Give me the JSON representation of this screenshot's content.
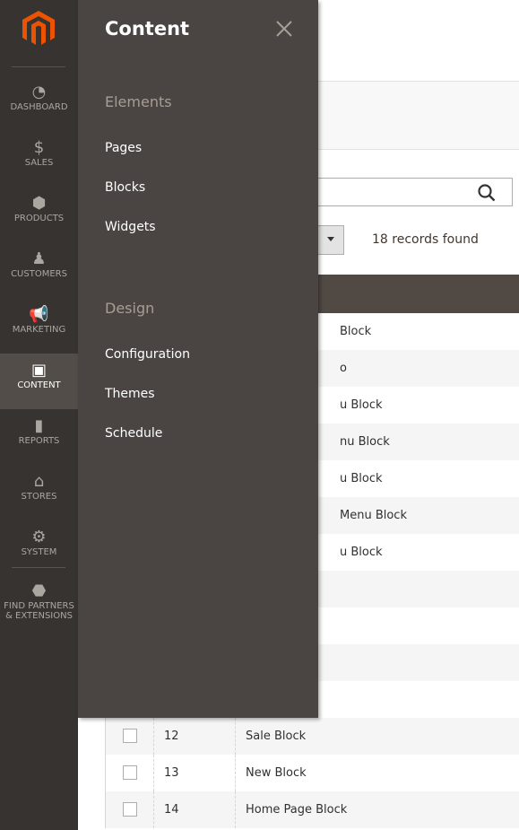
{
  "sidebar": {
    "items": [
      {
        "label": "DASHBOARD",
        "icon": "dashboard-icon"
      },
      {
        "label": "SALES",
        "icon": "dollar-icon"
      },
      {
        "label": "PRODUCTS",
        "icon": "box-icon"
      },
      {
        "label": "CUSTOMERS",
        "icon": "person-icon"
      },
      {
        "label": "MARKETING",
        "icon": "megaphone-icon"
      },
      {
        "label": "CONTENT",
        "icon": "layout-icon",
        "active": true
      },
      {
        "label": "REPORTS",
        "icon": "bar-chart-icon"
      },
      {
        "label": "STORES",
        "icon": "storefront-icon"
      },
      {
        "label": "SYSTEM",
        "icon": "gear-icon"
      },
      {
        "label": "FIND PARTNERS & EXTENSIONS",
        "icon": "blocks-icon"
      }
    ]
  },
  "flyout": {
    "title": "Content",
    "sections": [
      {
        "title": "Elements",
        "items": [
          "Pages",
          "Blocks",
          "Widgets"
        ]
      },
      {
        "title": "Design",
        "items": [
          "Configuration",
          "Themes",
          "Schedule"
        ]
      }
    ]
  },
  "grid": {
    "records": "18 records found",
    "visible_fragments": [
      "Block",
      "o",
      "u Block",
      "nu Block",
      "u Block",
      "Menu Block",
      "u Block",
      "",
      "",
      "",
      "",
      ""
    ],
    "rows": [
      {
        "id": "12",
        "title": "Sale Block"
      },
      {
        "id": "13",
        "title": "New Block"
      },
      {
        "id": "14",
        "title": "Home Page Block"
      }
    ]
  },
  "colors": {
    "accent": "#eb5202",
    "sidebar": "#373330",
    "flyout": "#4a4542",
    "header": "#514943"
  }
}
